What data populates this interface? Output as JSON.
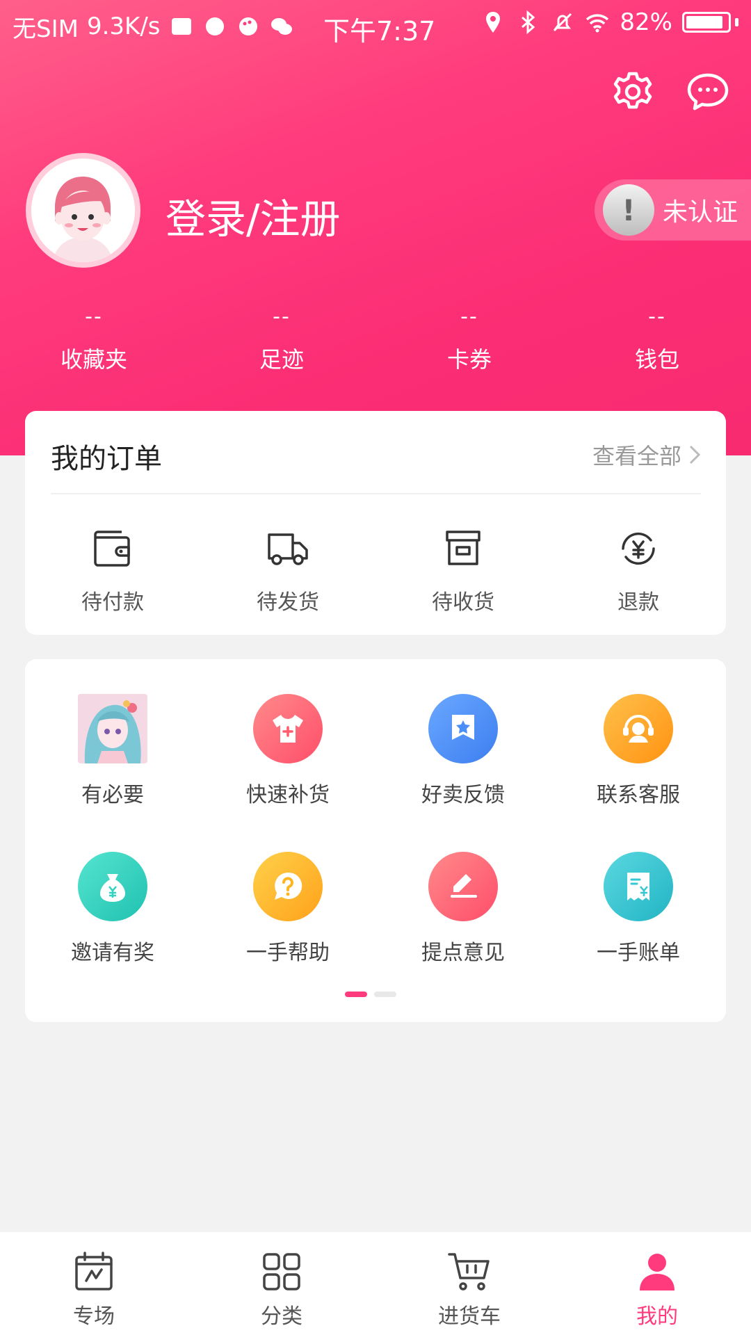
{
  "status_bar": {
    "carrier": "无SIM",
    "speed": "9.3K/s",
    "time": "下午7:37",
    "battery": "82%"
  },
  "header": {
    "login_label": "登录/注册",
    "verify_label": "未认证",
    "stats": [
      {
        "value": "--",
        "label": "收藏夹"
      },
      {
        "value": "--",
        "label": "足迹"
      },
      {
        "value": "--",
        "label": "卡券"
      },
      {
        "value": "--",
        "label": "钱包"
      }
    ]
  },
  "orders": {
    "title": "我的订单",
    "view_all": "查看全部",
    "items": [
      {
        "label": "待付款",
        "icon": "wallet-icon"
      },
      {
        "label": "待发货",
        "icon": "truck-icon"
      },
      {
        "label": "待收货",
        "icon": "box-icon"
      },
      {
        "label": "退款",
        "icon": "refund-icon"
      }
    ]
  },
  "services": {
    "items": [
      {
        "label": "有必要",
        "icon": "anime-thumbnail"
      },
      {
        "label": "快速补货",
        "icon": "shirt-plus-icon",
        "color": "#ff5a6e"
      },
      {
        "label": "好卖反馈",
        "icon": "badge-star-icon",
        "color": "#4a8ff7"
      },
      {
        "label": "联系客服",
        "icon": "headset-icon",
        "color": "#ffa41c"
      },
      {
        "label": "邀请有奖",
        "icon": "money-bag-icon",
        "color": "#2fd3c0"
      },
      {
        "label": "一手帮助",
        "icon": "question-bubble-icon",
        "color": "#ffb520"
      },
      {
        "label": "提点意见",
        "icon": "pen-icon",
        "color": "#ff5a6e"
      },
      {
        "label": "一手账单",
        "icon": "receipt-icon",
        "color": "#35c8d4"
      }
    ],
    "page_index": 1,
    "page_count": 2
  },
  "tabbar": {
    "items": [
      {
        "label": "专场"
      },
      {
        "label": "分类"
      },
      {
        "label": "进货车"
      },
      {
        "label": "我的"
      }
    ],
    "active": "我的"
  },
  "colors": {
    "brand": "#ff3b7d",
    "background": "#f2f2f2"
  }
}
